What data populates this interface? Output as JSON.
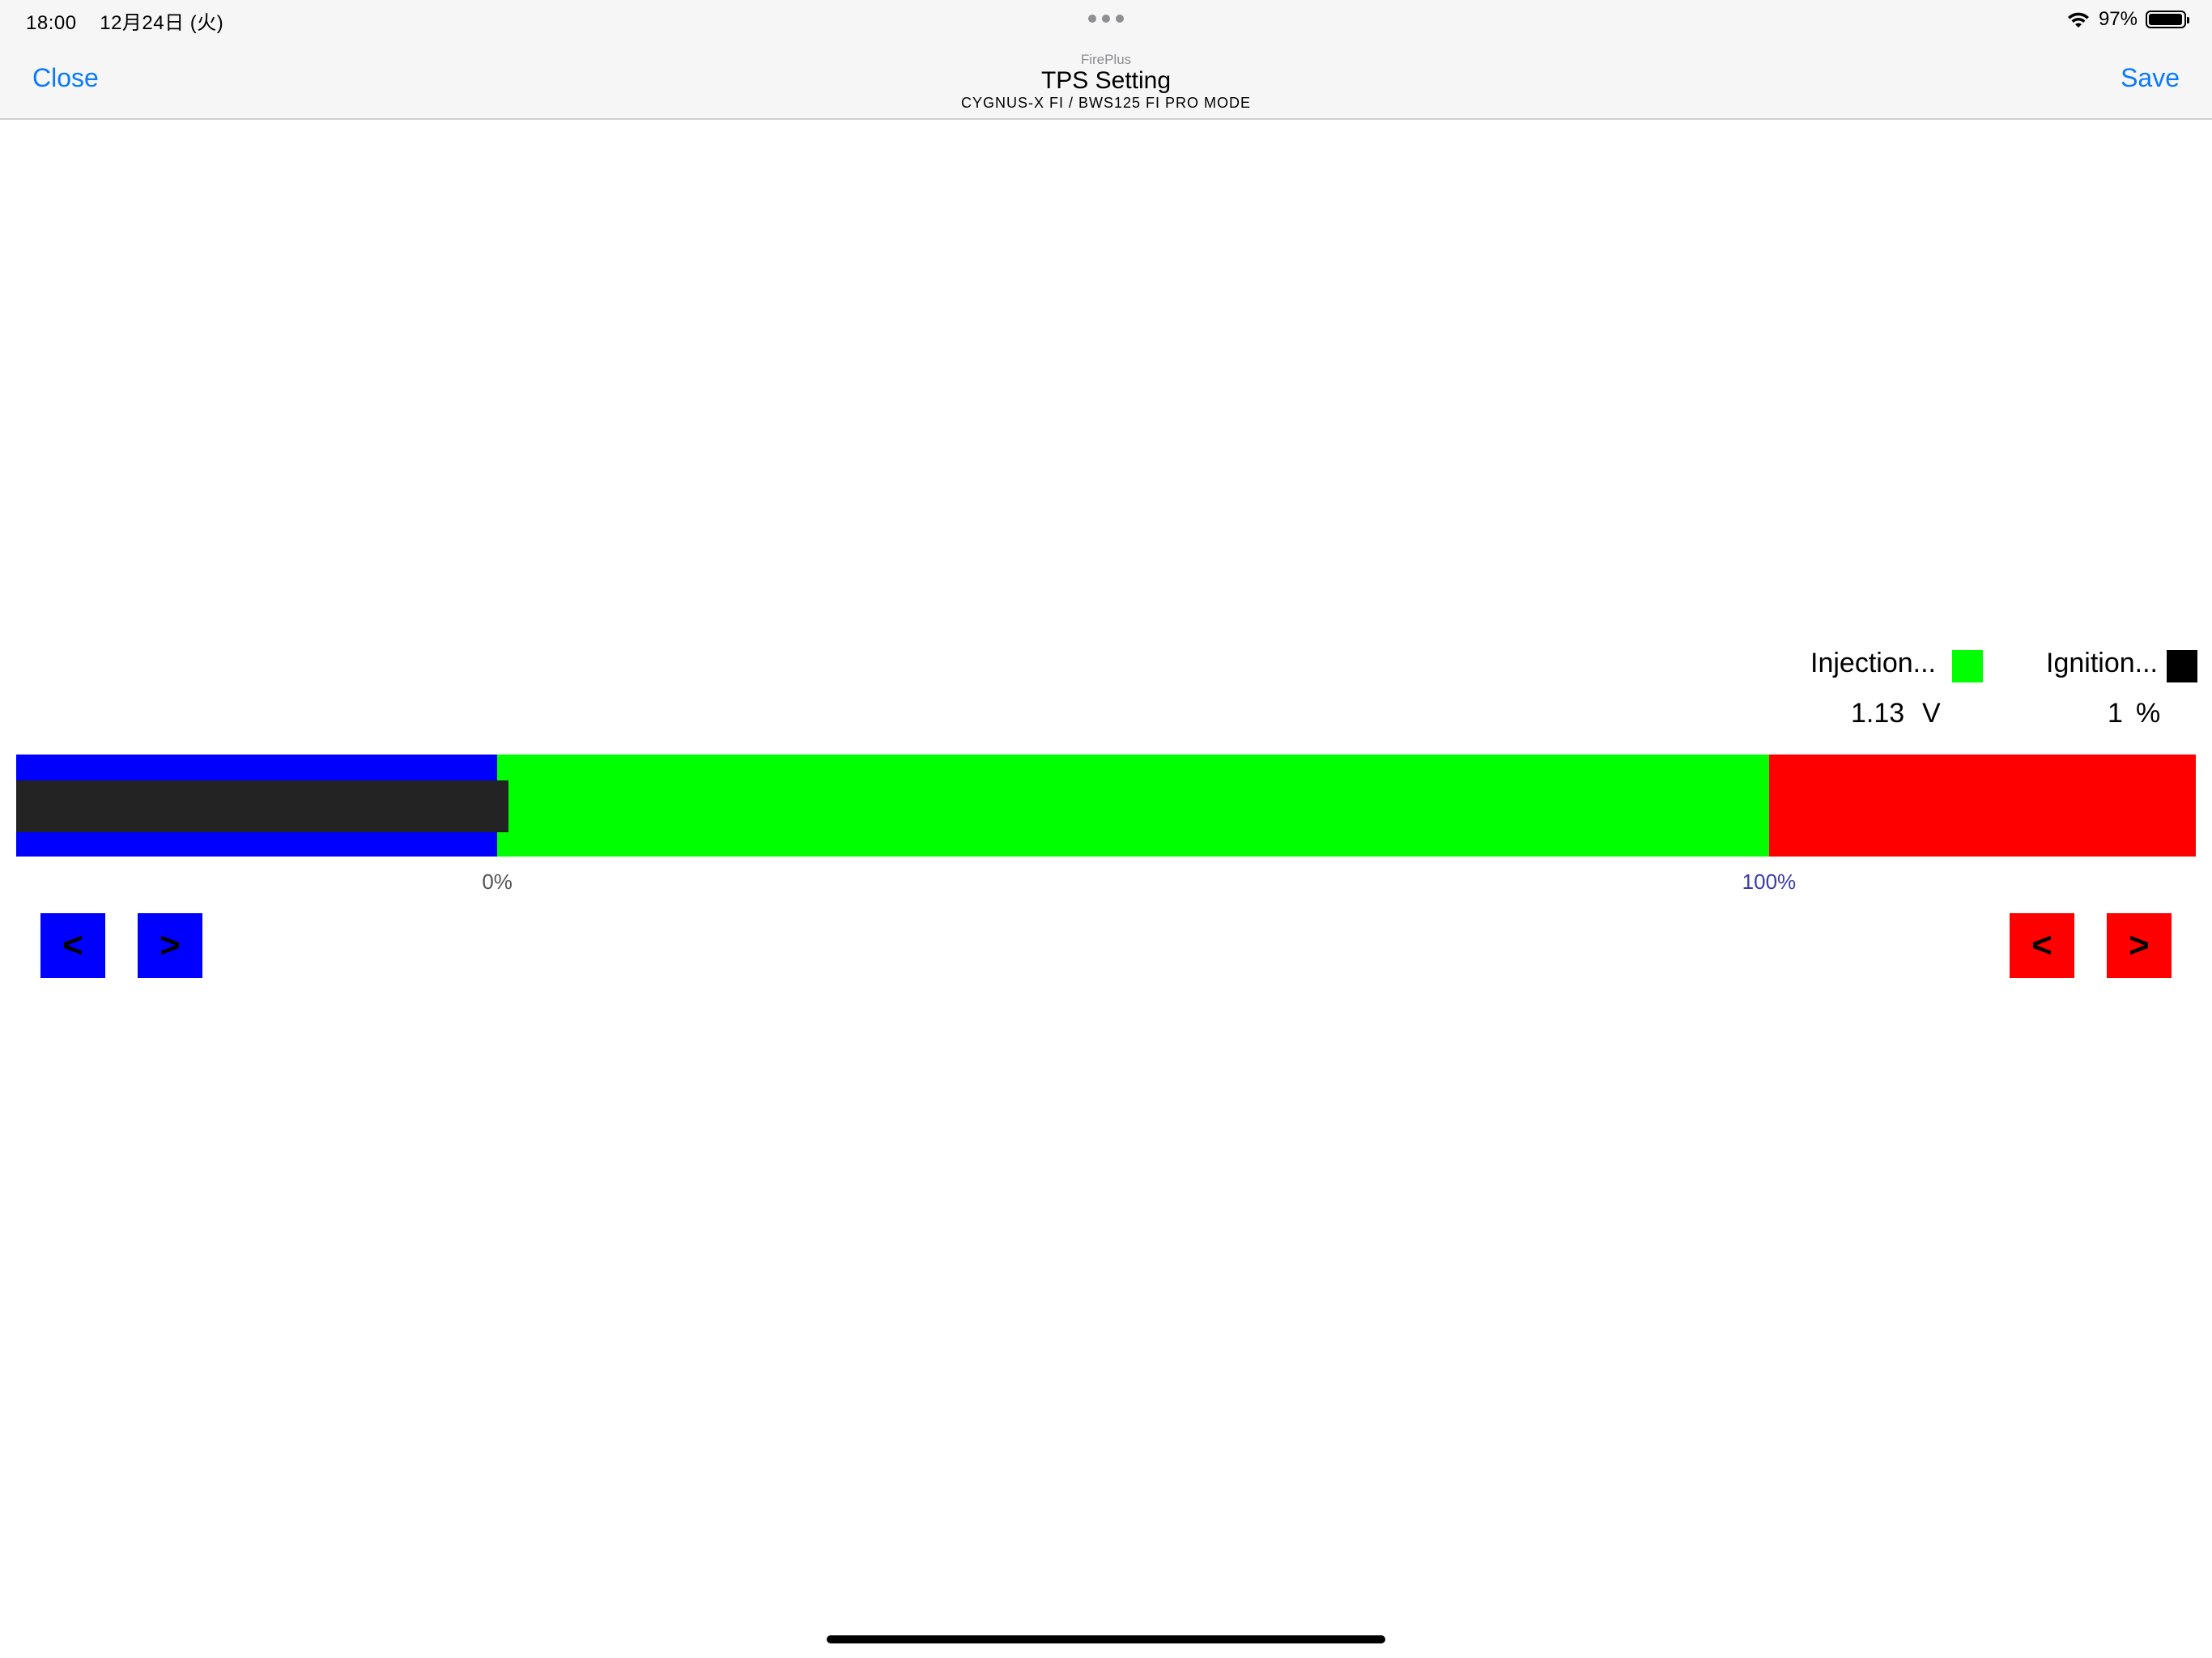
{
  "status_bar": {
    "time": "18:00",
    "date": "12月24日 (火)",
    "battery_percent": "97%",
    "battery_level": 0.97
  },
  "nav": {
    "close_label": "Close",
    "save_label": "Save",
    "app_name": "FirePlus",
    "title": "TPS Setting",
    "subtitle": "CYGNUS-X FI / BWS125 FI PRO MODE"
  },
  "legend": {
    "injection_label": "Injection...",
    "ignition_label": "Ignition...",
    "injection_color": "#00ff00",
    "ignition_color": "#000000"
  },
  "readouts": {
    "voltage_value": "1.13",
    "voltage_unit": "V",
    "percent_value": "1",
    "percent_unit": "%"
  },
  "tps_bar": {
    "colors": {
      "low": "#0000ff",
      "active": "#00ff00",
      "high": "#ff0000",
      "indicator": "#232323"
    },
    "zero_position": 0.2207,
    "full_position": 0.8042,
    "indicator_position": 0.2258,
    "tick_labels": {
      "zero": "0%",
      "full": "100%"
    }
  },
  "buttons": {
    "min_decrease": "<",
    "min_increase": ">",
    "max_decrease": "<",
    "max_increase": ">"
  }
}
